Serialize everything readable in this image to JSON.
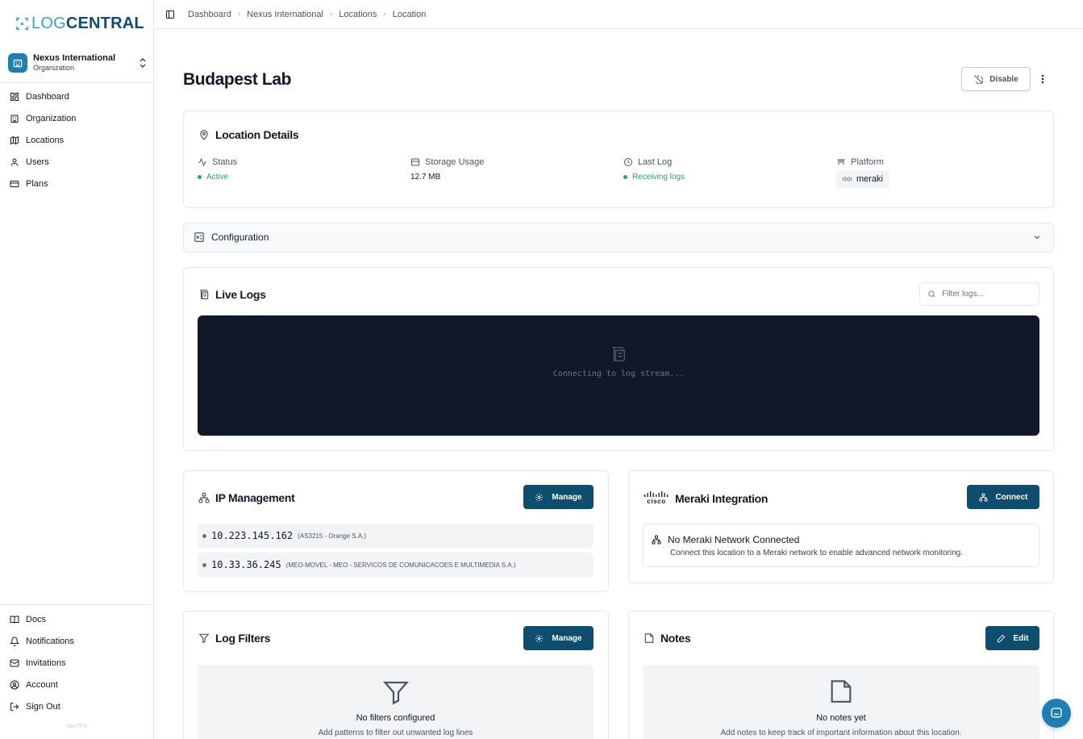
{
  "app": {
    "logo_part1": "LOG",
    "logo_part2": "CENTRAL",
    "version": "6ac7f7a"
  },
  "org": {
    "name": "Nexus International",
    "type": "Organization"
  },
  "nav": {
    "primary": [
      {
        "label": "Dashboard",
        "icon": "dashboard-icon"
      },
      {
        "label": "Organization",
        "icon": "building-icon"
      },
      {
        "label": "Locations",
        "icon": "map-icon"
      },
      {
        "label": "Users",
        "icon": "user-icon"
      },
      {
        "label": "Plans",
        "icon": "card-icon"
      }
    ],
    "secondary": [
      {
        "label": "Docs",
        "icon": "book-icon"
      },
      {
        "label": "Notifications",
        "icon": "bell-icon"
      },
      {
        "label": "Invitations",
        "icon": "mail-icon"
      },
      {
        "label": "Account",
        "icon": "account-icon"
      },
      {
        "label": "Sign Out",
        "icon": "sign-out-icon"
      }
    ]
  },
  "breadcrumb": [
    "Dashboard",
    "Nexus International",
    "Locations",
    "Location"
  ],
  "page": {
    "title": "Budapest Lab",
    "disable_label": "Disable"
  },
  "details": {
    "title": "Location Details",
    "status_label": "Status",
    "status_value": "Active",
    "storage_label": "Storage Usage",
    "storage_value": "12.7 MB",
    "lastlog_label": "Last Log",
    "lastlog_value": "Receiving logs",
    "platform_label": "Platform",
    "platform_value": "meraki"
  },
  "configuration": {
    "title": "Configuration"
  },
  "live_logs": {
    "title": "Live Logs",
    "filter_placeholder": "Filter logs...",
    "console_message": "Connecting to log stream..."
  },
  "ip_management": {
    "title": "IP Management",
    "manage_label": "Manage",
    "ips": [
      {
        "address": "10.223.145.162",
        "info": "(AS3215 - Orange S.A.)"
      },
      {
        "address": "10.33.36.245",
        "info": "(MEO-MOVEL - MEO - SERVICOS DE COMUNICACOES E MULTIMEDIA S.A.)"
      }
    ]
  },
  "meraki": {
    "title": "Meraki Integration",
    "logo_text": "cisco",
    "connect_label": "Connect",
    "status_title": "No Meraki Network Connected",
    "status_desc": "Connect this location to a Meraki network to enable advanced network monitoring."
  },
  "log_filters": {
    "title": "Log Filters",
    "manage_label": "Manage",
    "empty_title": "No filters configured",
    "empty_desc": "Add patterns to filter out unwanted log lines"
  },
  "notes": {
    "title": "Notes",
    "edit_label": "Edit",
    "empty_title": "No notes yet",
    "empty_desc": "Add notes to keep track of important information about this location."
  },
  "colors": {
    "brand": "#0f4d6e",
    "accent": "#1f7fb4",
    "status_active": "#2c9b8a",
    "console_bg": "#111827"
  }
}
